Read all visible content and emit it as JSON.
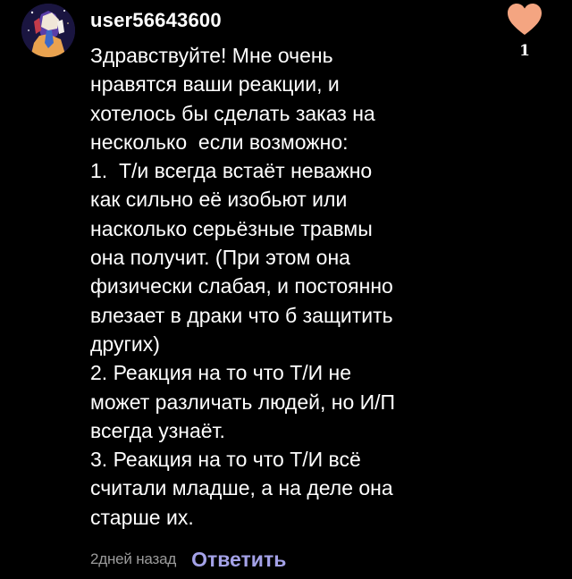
{
  "comment": {
    "username": "user56643600",
    "avatar_icon": "user-avatar-illustration",
    "body_lines": [
      "Здравствуйте! Мне очень",
      "нравятся ваши реакции, и",
      "хотелось бы сделать заказ на",
      "несколько  если возможно:",
      "1.  Т/и всегда встаёт неважно",
      "как сильно её изобьют или",
      "насколько серьёзные травмы",
      "она получит. (При этом она",
      "физически слабая, и постоянно",
      "влезает в драки что б защитить",
      "других)",
      "2. Реакция на то что Т/И не",
      "может различать людей, но И/П",
      "всегда узнаёт.",
      "3. Реакция на то что Т/И всё",
      "считали младше, а на деле она",
      "старше их."
    ],
    "time_ago": "2дней назад",
    "reply_label": "Ответить",
    "like_icon": "heart-icon",
    "like_count": "1"
  },
  "colors": {
    "background": "#000000",
    "text": "#ffffff",
    "muted": "#9b9b9b",
    "reply_accent": "#a4a2e8",
    "heart": "#f4a581"
  }
}
